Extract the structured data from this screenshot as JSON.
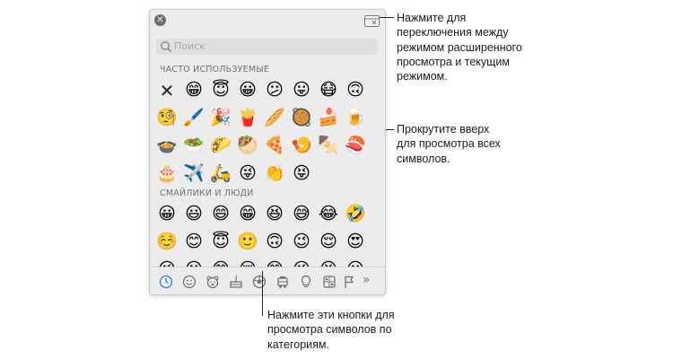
{
  "search": {
    "placeholder": "Поиск"
  },
  "sections": {
    "frequent": {
      "title": "ЧАСТО ИСПОЛЬЗУЕМЫЕ",
      "items": [
        "✕",
        "😁",
        "😇",
        "😀",
        "😕",
        "😛",
        "😷",
        "🙃",
        "🧐",
        "🖌️",
        "🎉",
        "🍟",
        "🥖",
        "🥘",
        "🍰",
        "🍺",
        "🍲",
        "🥗",
        "🌮",
        "🥙",
        "🍕",
        "🍤",
        "🍢",
        "🍣",
        "🎂",
        "✈️",
        "🛵",
        "😜",
        "👏",
        "😝"
      ]
    },
    "people": {
      "title": "СМАЙЛИКИ И ЛЮДИ",
      "items": [
        "😀",
        "😃",
        "😄",
        "😁",
        "😆",
        "😅",
        "😂",
        "🤣",
        "☺️",
        "😊",
        "😇",
        "🙂",
        "🙃",
        "😉",
        "😌",
        "😍",
        "😘",
        "😗",
        "😙",
        "😚",
        "😋",
        "😜",
        "😝",
        "😛"
      ]
    }
  },
  "tabs": [
    "clock-icon",
    "smiley-icon",
    "bear-icon",
    "food-icon",
    "ball-icon",
    "building-icon",
    "bulb-icon",
    "symbols-icon",
    "flag-icon"
  ],
  "more_label": "»",
  "callouts": {
    "toggle": "Нажмите для\nпереключения между\nрежимом расширенного\nпросмотра и текущим\nрежимом.",
    "scroll": "Прокрутите вверх\nдля просмотра всех\nсимволов.",
    "categories": "Нажмите эти кнопки для\nпросмотра символов по\nкатегориям."
  },
  "colors": {
    "accent": "#2f7fe0",
    "icon": "#6e6e6e"
  }
}
